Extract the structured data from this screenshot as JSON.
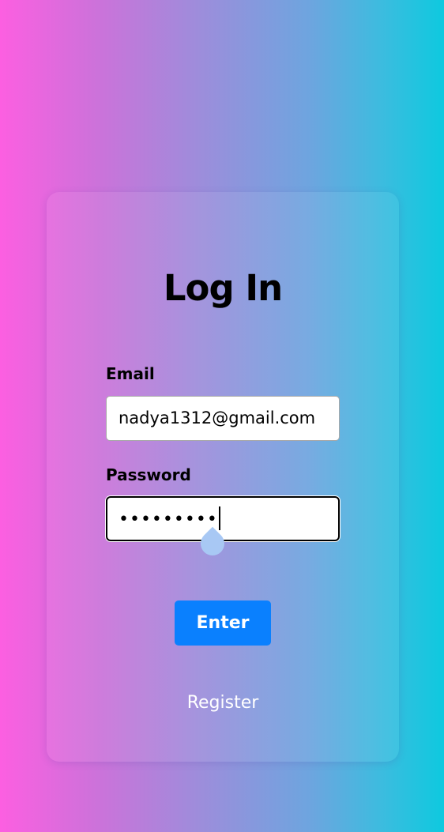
{
  "form": {
    "title": "Log In",
    "email_label": "Email",
    "email_value": "nadya1312@gmail.com",
    "password_label": "Password",
    "password_value": "•••••••••",
    "submit_label": "Enter",
    "register_label": "Register"
  },
  "colors": {
    "gradient_left": "#fc5fe1",
    "gradient_right": "#0ec9df",
    "button": "#0a80fe"
  },
  "icons": {
    "caret-handle": "text-cursor-handle"
  }
}
